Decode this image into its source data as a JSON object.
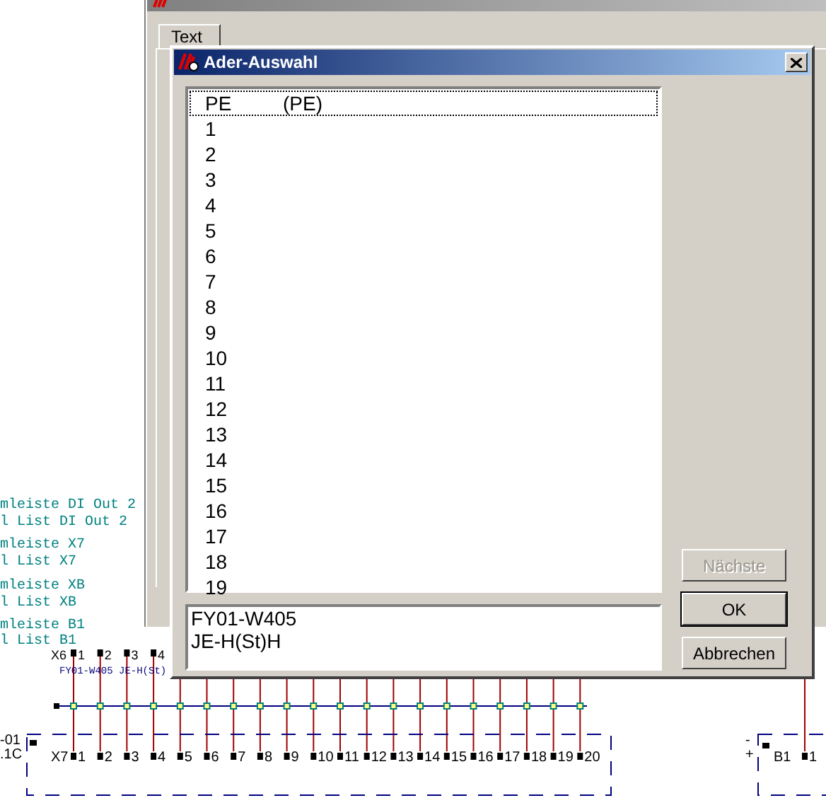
{
  "schematic": {
    "side_labels": [
      "mleiste DI Out 2",
      "l List DI Out 2",
      "mleiste X7",
      "l List X7",
      "mleiste XB",
      "l List XB",
      "mleiste B1",
      "l List B1"
    ],
    "top_strip": {
      "label": "X6",
      "terminals": [
        "1",
        "2",
        "3",
        "4"
      ]
    },
    "cable_label": "FY01-W405 JE-H(St)",
    "box_labels": [
      "-01",
      ".1C"
    ],
    "bottom_strip": {
      "label": "X7",
      "terminals": [
        "1",
        "2",
        "3",
        "4",
        "5",
        "6",
        "7",
        "8",
        "9",
        "10",
        "11",
        "12",
        "13",
        "14",
        "15",
        "16",
        "17",
        "18",
        "19",
        "20"
      ]
    },
    "device": {
      "polarity": [
        "-",
        "+"
      ],
      "label": "B1",
      "terminals": [
        "1"
      ]
    }
  },
  "parent_window": {
    "tabs": [
      {
        "label": "Text",
        "selected": true
      }
    ]
  },
  "dialog": {
    "title": "Ader-Auswahl",
    "items": [
      {
        "label": "PE",
        "note": "(PE)",
        "selected": true
      },
      {
        "label": "1",
        "selected": false
      },
      {
        "label": "2",
        "selected": false
      },
      {
        "label": "3",
        "selected": false
      },
      {
        "label": "4",
        "selected": false
      },
      {
        "label": "5",
        "selected": false
      },
      {
        "label": "6",
        "selected": false
      },
      {
        "label": "7",
        "selected": false
      },
      {
        "label": "8",
        "selected": false
      },
      {
        "label": "9",
        "selected": false
      },
      {
        "label": "10",
        "selected": false
      },
      {
        "label": "11",
        "selected": false
      },
      {
        "label": "12",
        "selected": false
      },
      {
        "label": "13",
        "selected": false
      },
      {
        "label": "14",
        "selected": false
      },
      {
        "label": "15",
        "selected": false
      },
      {
        "label": "16",
        "selected": false
      },
      {
        "label": "17",
        "selected": false
      },
      {
        "label": "18",
        "selected": false
      },
      {
        "label": "19",
        "selected": false
      }
    ],
    "info": [
      "FY01-W405",
      "JE-H(St)H"
    ],
    "buttons": [
      {
        "label": "Nächste",
        "disabled": true,
        "default": false
      },
      {
        "label": "OK",
        "disabled": false,
        "default": true
      },
      {
        "label": "Abbrechen",
        "disabled": false,
        "default": false
      }
    ]
  }
}
